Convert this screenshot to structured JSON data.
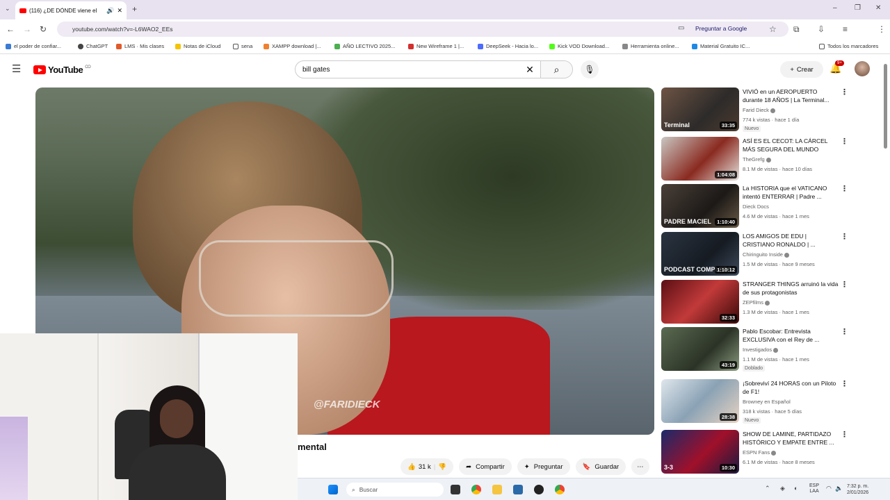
{
  "browser": {
    "tab_title": "(116) ¿DE DÓNDE viene el",
    "url": "youtube.com/watch?v=-L6WAO2_EEs",
    "ask_google": "Preguntar a Google",
    "bookmarks": [
      "el poder de confiar...",
      "ChatGPT",
      "LMS · Mis clases",
      "Notas de iCloud",
      "sena",
      "XAMPP download |...",
      "AÑO LECTIVO 2025...",
      "New Wireframe 1 |...",
      "DeepSeek - Hacia lo...",
      "Kick VOD Download...",
      "Herramienta online...",
      "Material Gratuito IC..."
    ],
    "all_bookmarks": "Todos los marcadores"
  },
  "youtube": {
    "logo": "YouTube",
    "logo_country": "CO",
    "search_value": "bill gates",
    "create_label": "Crear",
    "notif_count": "9+",
    "video_title_visible": "mental",
    "watermark": "@FARIDIECK",
    "likes": "31 k",
    "share": "Compartir",
    "ask": "Preguntar",
    "save": "Guardar"
  },
  "recommendations": [
    {
      "title": "VIVIÓ en un AEROPUERTO durante 18 AÑOS | La Terminal...",
      "channel": "Farid Dieck",
      "verified": true,
      "meta": "774 k vistas · hace 1 día",
      "duration": "33:35",
      "badge": "Nuevo",
      "thumb": "linear-gradient(135deg,#6e5444,#2d2b2a 60%,#4c3a2e)",
      "thumb_text": "Terminal"
    },
    {
      "title": "ASÍ ES EL CECOT: LA CÁRCEL MÁS SEGURA DEL MUNDO",
      "channel": "TheGrefg",
      "verified": true,
      "meta": "8.1 M de vistas · hace 10 días",
      "duration": "1:04:08",
      "badge": "",
      "thumb": "linear-gradient(135deg,#c9c7c2,#8a2a20 55%,#e5e2dd)",
      "thumb_text": ""
    },
    {
      "title": "La HISTORIA que el VATICANO intentó ENTERRAR | Padre ...",
      "channel": "Dieck Docs",
      "verified": false,
      "meta": "4.6 M de vistas · hace 1 mes",
      "duration": "1:10:40",
      "badge": "",
      "thumb": "linear-gradient(135deg,#4a4038,#1c1917 60%,#6a5a45)",
      "thumb_text": "PADRE MACIEL"
    },
    {
      "title": "LOS AMIGOS DE EDU | CRISTIANO RONALDO | ...",
      "channel": "Chiringuito Inside",
      "verified": true,
      "meta": "1.5 M de vistas · hace 9 meses",
      "duration": "1:10:12",
      "badge": "",
      "thumb": "linear-gradient(135deg,#2a3441,#161b22 60%,#3d4a5c)",
      "thumb_text": "PODCAST COMPLETO"
    },
    {
      "title": "STRANGER THINGS arruinó la vida de sus protagonistas",
      "channel": "ZEPfilms",
      "verified": true,
      "meta": "1.3 M de vistas · hace 1 mes",
      "duration": "32:33",
      "badge": "",
      "thumb": "linear-gradient(135deg,#5a0f14,#c23a3a 50%,#3a0808)",
      "thumb_text": ""
    },
    {
      "title": "Pablo Escobar: Entrevista EXCLUSIVA con el Rey de ...",
      "channel": "Investigados",
      "verified": true,
      "meta": "1.1 M de vistas · hace 1 mes",
      "duration": "43:19",
      "badge": "Doblado",
      "thumb": "linear-gradient(135deg,#5b6b52,#2b3326 60%,#8a9a7e)",
      "thumb_text": ""
    },
    {
      "title": "¡Sobreviví 24 HORAS con un Piloto de F1!",
      "channel": "Browney en Español",
      "verified": false,
      "meta": "318 k vistas · hace 5 días",
      "duration": "28:38",
      "badge": "Nuevo",
      "thumb": "linear-gradient(135deg,#dfe6ec,#8aa2b5 50%,#e8d3c2)",
      "thumb_text": ""
    },
    {
      "title": "SHOW DE LAMINE, PARTIDAZO HISTÓRICO Y EMPATE ENTRE ...",
      "channel": "ESPN Fans",
      "verified": true,
      "meta": "6.1 M de vistas · hace 8 meses",
      "duration": "10:30",
      "badge": "",
      "thumb": "linear-gradient(135deg,#1a2a6a,#a0102a 55%,#1a1a40)",
      "thumb_text": "3-3"
    }
  ],
  "taskbar": {
    "search": "Buscar",
    "lang1": "ESP",
    "lang2": "LAA",
    "time": "7:32 p. m.",
    "date": "2/01/2026"
  }
}
